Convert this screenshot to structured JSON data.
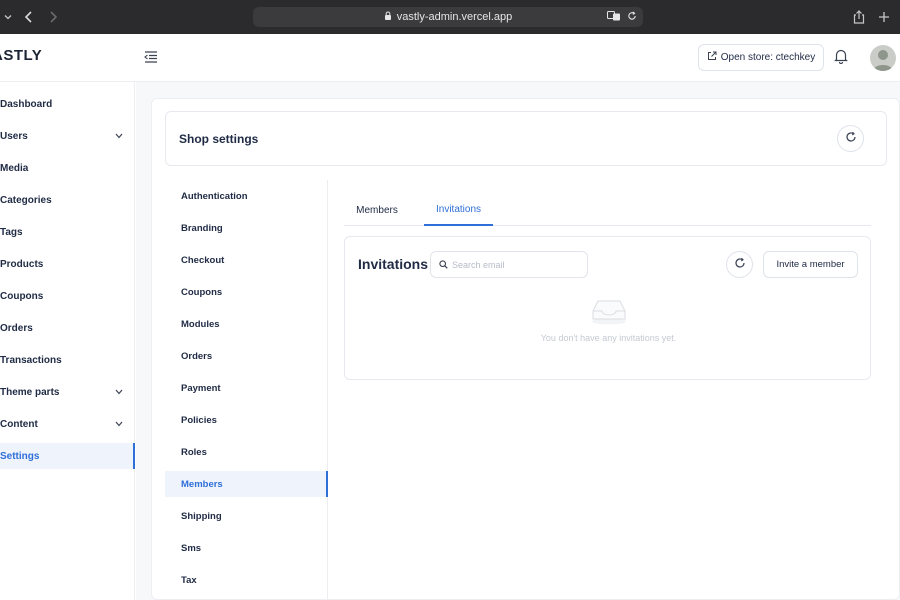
{
  "browser": {
    "url": "vastly-admin.vercel.app"
  },
  "header": {
    "logo": "ASTLY",
    "open_store_label": "Open store: ctechkey"
  },
  "sidebar": {
    "items": [
      {
        "label": "Dashboard",
        "has_chevron": false
      },
      {
        "label": "Users",
        "has_chevron": true
      },
      {
        "label": "Media",
        "has_chevron": false
      },
      {
        "label": "Categories",
        "has_chevron": false
      },
      {
        "label": "Tags",
        "has_chevron": false
      },
      {
        "label": "Products",
        "has_chevron": false
      },
      {
        "label": "Coupons",
        "has_chevron": false
      },
      {
        "label": "Orders",
        "has_chevron": false
      },
      {
        "label": "Transactions",
        "has_chevron": false
      },
      {
        "label": "Theme parts",
        "has_chevron": true
      },
      {
        "label": "Content",
        "has_chevron": true
      },
      {
        "label": "Settings",
        "has_chevron": false,
        "active": true
      }
    ]
  },
  "shop_settings": {
    "title": "Shop settings"
  },
  "settings_nav": {
    "items": [
      {
        "label": "Authentication"
      },
      {
        "label": "Branding"
      },
      {
        "label": "Checkout"
      },
      {
        "label": "Coupons"
      },
      {
        "label": "Modules"
      },
      {
        "label": "Orders"
      },
      {
        "label": "Payment"
      },
      {
        "label": "Policies"
      },
      {
        "label": "Roles"
      },
      {
        "label": "Members",
        "active": true
      },
      {
        "label": "Shipping"
      },
      {
        "label": "Sms"
      },
      {
        "label": "Tax"
      }
    ]
  },
  "tabs": [
    {
      "label": "Members",
      "active": false
    },
    {
      "label": "Invitations",
      "active": true
    }
  ],
  "invitations": {
    "title": "Invitations",
    "search_placeholder": "Search email",
    "invite_button": "Invite a member",
    "empty_text": "You don't have any invitations yet."
  },
  "colors": {
    "accent": "#2f6fd8",
    "active_bg": "#eef3fc",
    "chrome": "#2b2b2d"
  }
}
